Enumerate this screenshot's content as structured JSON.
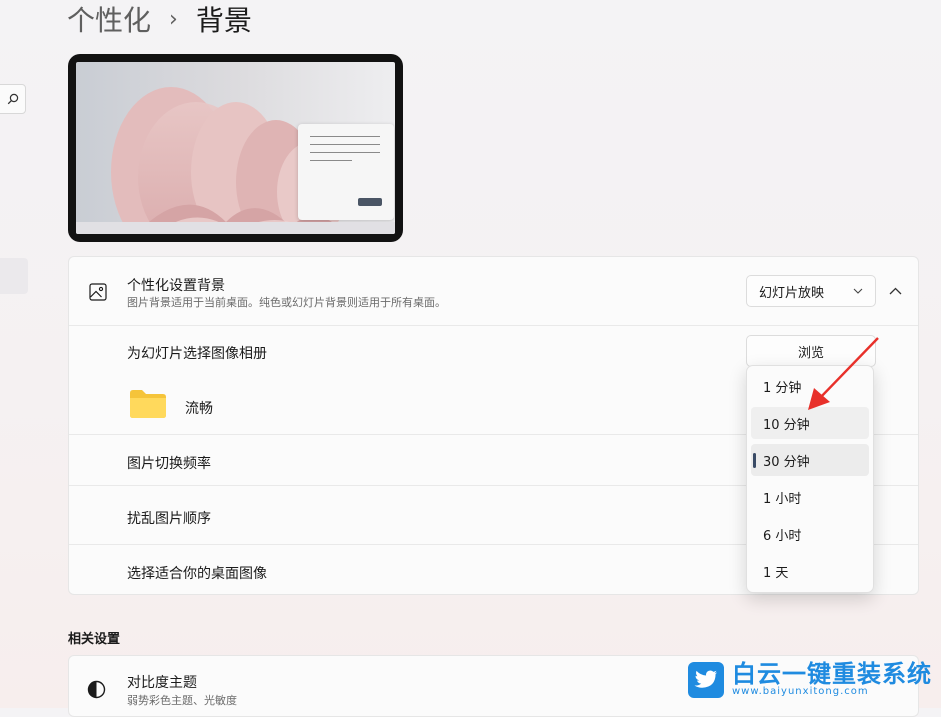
{
  "breadcrumb": {
    "parent": "个性化",
    "separator": "›",
    "current": "背景"
  },
  "background_card": {
    "title": "个性化设置背景",
    "subtitle": "图片背景适用于当前桌面。纯色或幻灯片背景则适用于所有桌面。",
    "combo_value": "幻灯片放映"
  },
  "album": {
    "label": "为幻灯片选择图像相册",
    "browse_label": "浏览",
    "folder_name": "流畅"
  },
  "settings_rows": {
    "interval_label": "图片切换频率",
    "shuffle_label": "扰乱图片顺序",
    "fit_label": "选择适合你的桌面图像"
  },
  "interval_dropdown": {
    "options": [
      "1 分钟",
      "10 分钟",
      "30 分钟",
      "1 小时",
      "6 小时",
      "1 天"
    ],
    "selected": "30 分钟",
    "hovered": "10 分钟"
  },
  "related": {
    "heading": "相关设置",
    "contrast_title": "对比度主题",
    "contrast_subtitle": "弱势彩色主题、光敏度"
  },
  "watermark": {
    "title": "白云一键重装系统",
    "url": "www.baiyunxitong.com"
  },
  "colors": {
    "accent": "#1f8be0",
    "arrow": "#e8302a",
    "selection_indicator": "#3a4b66"
  }
}
